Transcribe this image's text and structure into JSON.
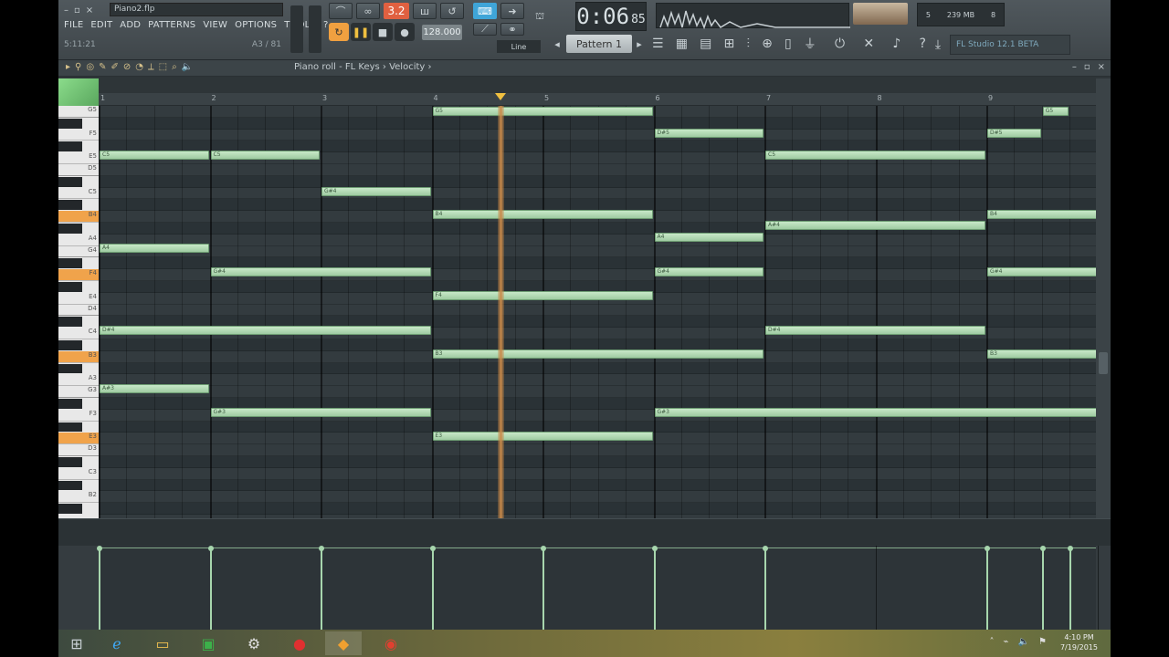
{
  "window": {
    "file_name": "Piano2.flp",
    "hint_left": "5:11:21",
    "hint_right": "A3 / 81"
  },
  "menu": [
    "FILE",
    "EDIT",
    "ADD",
    "PATTERNS",
    "VIEW",
    "OPTIONS",
    "TOOLS",
    "?"
  ],
  "transport": {
    "time_main": "0:06",
    "time_small": "85",
    "bpm": "128.000",
    "pattern": "Pattern 1",
    "pat_song": "3.2",
    "snap": "Line"
  },
  "version_label": "FL Studio 12.1 BETA",
  "cpu": {
    "value": "5",
    "mem": "239 MB",
    "poly": "8"
  },
  "piano_roll": {
    "path": "Piano roll - FL Keys › Velocity ›",
    "bars": [
      "1",
      "2",
      "3",
      "4",
      "5",
      "6",
      "7",
      "8",
      "9"
    ]
  },
  "keys": [
    {
      "label": "G5",
      "white": true
    },
    {
      "label": "F5",
      "white": true
    },
    {
      "label": "E5",
      "white": true
    },
    {
      "label": "D5",
      "white": true
    },
    {
      "label": "C5",
      "white": true
    },
    {
      "label": "B4",
      "white": true,
      "hl": true
    },
    {
      "label": "A4",
      "white": true
    },
    {
      "label": "G4",
      "white": true
    },
    {
      "label": "F4",
      "white": true,
      "hl": true
    },
    {
      "label": "E4",
      "white": true
    },
    {
      "label": "D4",
      "white": true
    },
    {
      "label": "C4",
      "white": true
    },
    {
      "label": "B3",
      "white": true,
      "hl": true
    },
    {
      "label": "A3",
      "white": true
    },
    {
      "label": "G3",
      "white": true
    },
    {
      "label": "F3",
      "white": true
    },
    {
      "label": "E3",
      "white": true,
      "hl": true
    },
    {
      "label": "D3",
      "white": true
    },
    {
      "label": "C3",
      "white": true
    },
    {
      "label": "B2",
      "white": true
    }
  ],
  "notes": [
    {
      "bar": 0,
      "len": 1,
      "row": 48,
      "label": "C5"
    },
    {
      "bar": 1,
      "len": 1,
      "row": 48,
      "label": "C5"
    },
    {
      "bar": 2,
      "len": 1,
      "row": 88,
      "label": "G#4"
    },
    {
      "bar": 3,
      "len": 2,
      "row": 0,
      "label": "G5"
    },
    {
      "bar": 5,
      "len": 1,
      "row": 24,
      "label": "D#5"
    },
    {
      "bar": 6,
      "len": 2,
      "row": 48,
      "label": "C5"
    },
    {
      "bar": 8,
      "len": 0.5,
      "row": 24,
      "label": "D#5"
    },
    {
      "bar": 8.5,
      "len": 0.25,
      "row": 0,
      "label": "G5"
    },
    {
      "bar": 3,
      "len": 2,
      "row": 113,
      "label": "B4"
    },
    {
      "bar": 8,
      "len": 1,
      "row": 113,
      "label": "B4"
    },
    {
      "bar": 6,
      "len": 2,
      "row": 125,
      "label": "A#4"
    },
    {
      "bar": 0,
      "len": 1,
      "row": 150,
      "label": "A4"
    },
    {
      "bar": 5,
      "len": 1,
      "row": 138,
      "label": "A4"
    },
    {
      "bar": 1,
      "len": 2,
      "row": 176,
      "label": "G#4"
    },
    {
      "bar": 5,
      "len": 1,
      "row": 176,
      "label": "G#4"
    },
    {
      "bar": 8,
      "len": 1,
      "row": 176,
      "label": "G#4"
    },
    {
      "bar": 3,
      "len": 2,
      "row": 202,
      "label": "F4"
    },
    {
      "bar": 0,
      "len": 3,
      "row": 240,
      "label": "D#4"
    },
    {
      "bar": 6,
      "len": 2,
      "row": 240,
      "label": "D#4"
    },
    {
      "bar": 3,
      "len": 3,
      "row": 266,
      "label": "B3"
    },
    {
      "bar": 8,
      "len": 1,
      "row": 266,
      "label": "B3"
    },
    {
      "bar": 0,
      "len": 1,
      "row": 304,
      "label": "A#3"
    },
    {
      "bar": 1,
      "len": 2,
      "row": 330,
      "label": "G#3"
    },
    {
      "bar": 5,
      "len": 4,
      "row": 330,
      "label": "G#3"
    },
    {
      "bar": 3,
      "len": 2,
      "row": 356,
      "label": "E3"
    }
  ],
  "playhead_bar": 3.6,
  "velocity_stems": [
    0,
    1,
    2,
    3,
    4,
    5,
    6,
    8,
    8.5,
    8.75
  ],
  "taskbar": {
    "icons": [
      "windows-icon",
      "ie-icon",
      "explorer-icon",
      "excel-icon",
      "steam-icon",
      "record-icon",
      "fl-icon",
      "chrome-icon"
    ],
    "time": "4:10 PM",
    "date": "7/19/2015"
  }
}
